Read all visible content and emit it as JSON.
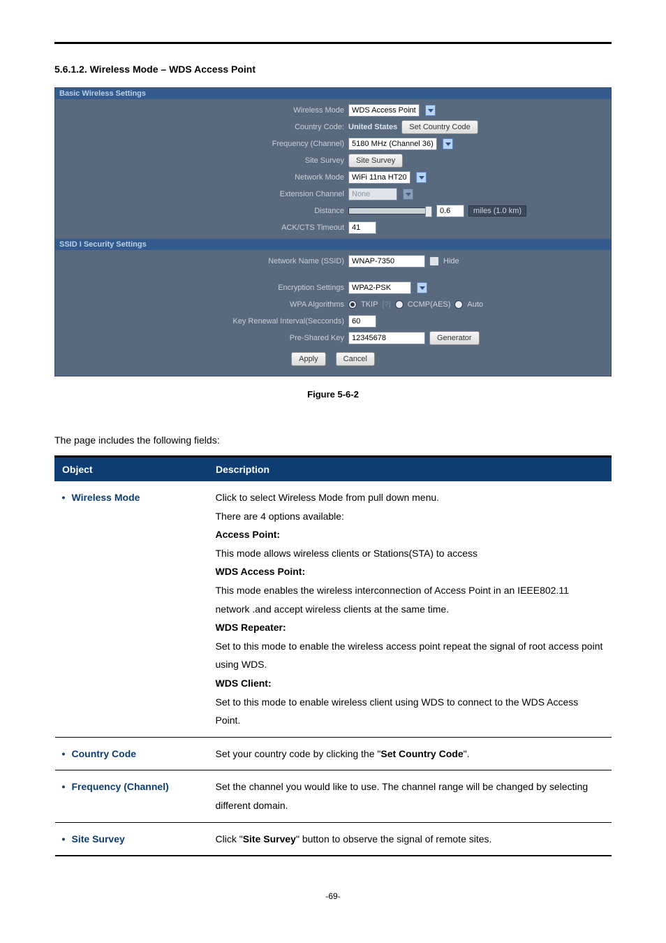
{
  "heading": {
    "number": "5.6.1.2.",
    "title": "Wireless Mode – WDS Access Point"
  },
  "screenshot": {
    "panel1_title": "Basic Wireless Settings",
    "panel2_title": "SSID I Security Settings",
    "rows": {
      "wireless_mode": {
        "label": "Wireless Mode",
        "value": "WDS Access Point"
      },
      "country_code": {
        "label": "Country Code:",
        "value": "United States",
        "btn": "Set Country Code"
      },
      "frequency": {
        "label": "Frequency (Channel)",
        "value": "5180 MHz (Channel 36)"
      },
      "site_survey": {
        "label": "Site Survey",
        "btn": "Site Survey"
      },
      "network_mode": {
        "label": "Network Mode",
        "value": "WiFi 11na HT20"
      },
      "ext_channel": {
        "label": "Extension Channel",
        "value": "None"
      },
      "distance": {
        "label": "Distance",
        "value": "0.6",
        "unit": "miles (1.0 km)"
      },
      "ack": {
        "label": "ACK/CTS Timeout",
        "value": "41"
      },
      "ssid": {
        "label": "Network Name (SSID)",
        "value": "WNAP-7350",
        "hide": "Hide"
      },
      "encryption": {
        "label": "Encryption Settings",
        "value": "WPA2-PSK"
      },
      "wpa_alg": {
        "label": "WPA Algorithms",
        "opt1": "TKIP",
        "q": "[?]",
        "opt2": "CCMP(AES)",
        "opt3": "Auto"
      },
      "key_renew": {
        "label": "Key Renewal Interval(Secconds)",
        "value": "60"
      },
      "psk": {
        "label": "Pre-Shared Key",
        "value": "12345678",
        "btn": "Generator"
      },
      "apply": "Apply",
      "cancel": "Cancel"
    }
  },
  "figure_caption": "Figure 5-6-2",
  "intro_text": "The page includes the following fields:",
  "table": {
    "head_object": "Object",
    "head_desc": "Description",
    "rows": [
      {
        "object": "Wireless Mode",
        "desc_lines": [
          "Click to select Wireless Mode from pull down menu.",
          "There are 4 options available:",
          "Access Point:",
          "This mode allows wireless clients or Stations(STA) to access",
          "WDS Access Point:",
          "This mode enables the wireless interconnection of Access Point in an IEEE802.11 network .and accept wireless clients at the same time.",
          "WDS Repeater:",
          "Set to this mode to enable the wireless access point repeat the signal of root access point using WDS.",
          "WDS Client:",
          "Set to this mode to enable wireless client using WDS to connect to the WDS Access Point."
        ],
        "bold_idx": [
          2,
          4,
          6,
          8
        ]
      },
      {
        "object": "Country Code",
        "desc_lines": [
          "Set your country code by clicking the \"",
          "Set Country Code",
          "\"."
        ],
        "inline_bold_idx": 1
      },
      {
        "object": "Frequency (Channel)",
        "desc_lines": [
          "Set the channel you would like to use. The channel range will be changed by selecting different domain."
        ]
      },
      {
        "object": "Site Survey",
        "desc_lines": [
          "Click \"",
          "Site Survey",
          "\" button to observe the signal of remote sites."
        ],
        "inline_bold_idx": 1,
        "heavy": true
      }
    ]
  },
  "page_number": "-69-"
}
